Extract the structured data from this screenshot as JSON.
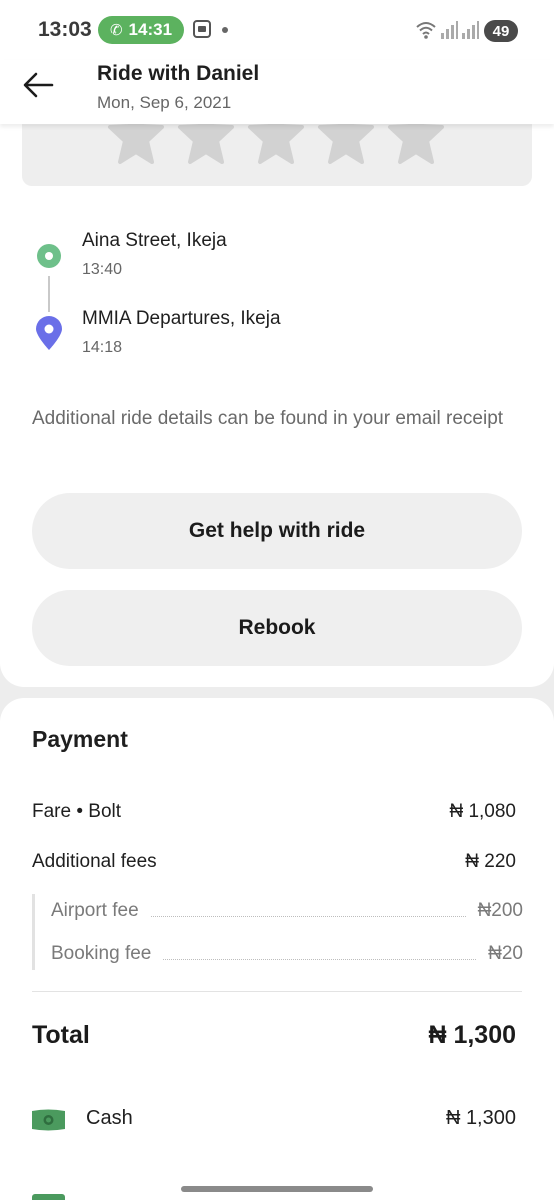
{
  "status_bar": {
    "time": "13:03",
    "call_timer": "14:31",
    "battery": "49"
  },
  "header": {
    "title": "Ride with Daniel",
    "date": "Mon, Sep 6, 2021"
  },
  "rating": {
    "stars_total": 5,
    "stars_selected": 0
  },
  "route": {
    "pickup": {
      "name": "Aina Street, Ikeja",
      "time": "13:40"
    },
    "dropoff": {
      "name": "MMIA Departures, Ikeja",
      "time": "14:18"
    }
  },
  "note": "Additional ride details can be found in your email receipt",
  "buttons": {
    "help": "Get help with ride",
    "rebook": "Rebook"
  },
  "payment": {
    "title": "Payment",
    "fare_label": "Fare • Bolt",
    "fare_amount": "₦ 1,080",
    "additional_label": "Additional fees",
    "additional_amount": "₦ 220",
    "airport_label": "Airport fee",
    "airport_amount": "₦200",
    "booking_label": "Booking fee",
    "booking_amount": "₦20",
    "total_label": "Total",
    "total_amount": "₦ 1,300",
    "method_label": "Cash",
    "method_amount": "₦ 1,300"
  },
  "colors": {
    "accent_green": "#5cb25f",
    "pickup_pin": "#6ec08a",
    "dropoff_pin": "#6a6fe8",
    "button_bg": "#efefef"
  }
}
